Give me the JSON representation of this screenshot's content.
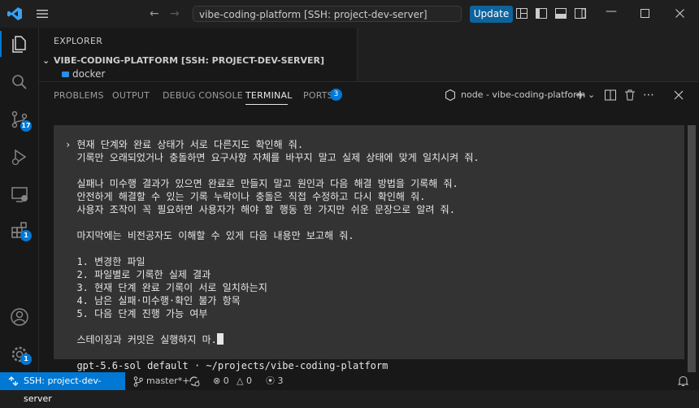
{
  "titlebar": {
    "search_text": "vibe-coding-platform [SSH: project-dev-server]",
    "update_label": "Update"
  },
  "activity_bar": {
    "items": [
      "explorer-icon",
      "search-icon",
      "source-control-icon",
      "run-debug-icon",
      "remote-explorer-icon",
      "extensions-icon",
      "accounts-icon",
      "settings-icon"
    ],
    "source_control_badge": "17",
    "extensions_badge": "1",
    "settings_badge": "1"
  },
  "sidebar": {
    "title": "EXPLORER",
    "folder": "VIBE-CODING-PLATFORM [SSH: PROJECT-DEV-SERVER]",
    "partial_item": "docker"
  },
  "panel": {
    "tabs": [
      "PROBLEMS",
      "OUTPUT",
      "DEBUG CONSOLE",
      "TERMINAL",
      "PORTS"
    ],
    "active_tab": "TERMINAL",
    "ports_badge": "3",
    "terminal_name": "node - vibe-coding-platform"
  },
  "terminal": {
    "lines": [
      "› 현재 단계와 완료 상태가 서로 다른지도 확인해 줘.",
      "  기록만 오래되었거나 충돌하면 요구사항 자체를 바꾸지 말고 실제 상태에 맞게 일치시켜 줘.",
      "",
      "  실패나 미수행 결과가 있으면 완료로 만들지 말고 원인과 다음 해결 방법을 기록해 줘.",
      "  안전하게 해결할 수 있는 기록 누락이나 충돌은 직접 수정하고 다시 확인해 줘.",
      "  사용자 조작이 꼭 필요하면 사용자가 해야 할 행동 한 가지만 쉬운 문장으로 알려 줘.",
      "",
      "  마지막에는 비전공자도 이해할 수 있게 다음 내용만 보고해 줘.",
      "",
      "  1. 변경한 파일",
      "  2. 파일별로 기록한 실제 결과",
      "  3. 현재 단계 완료 기록이 서로 일치하는지",
      "  4. 남은 실패·미수행·확인 불가 항목",
      "  5. 다음 단계 진행 가능 여부",
      "",
      "  스테이징과 커밋은 실행하지 마."
    ],
    "prompt": "  gpt-5.6-sol default · ~/projects/vibe-coding-platform"
  },
  "statusbar": {
    "remote": "SSH: project-dev-server",
    "branch": "master*+",
    "errors": "0",
    "warnings": "0",
    "ports": "3"
  }
}
